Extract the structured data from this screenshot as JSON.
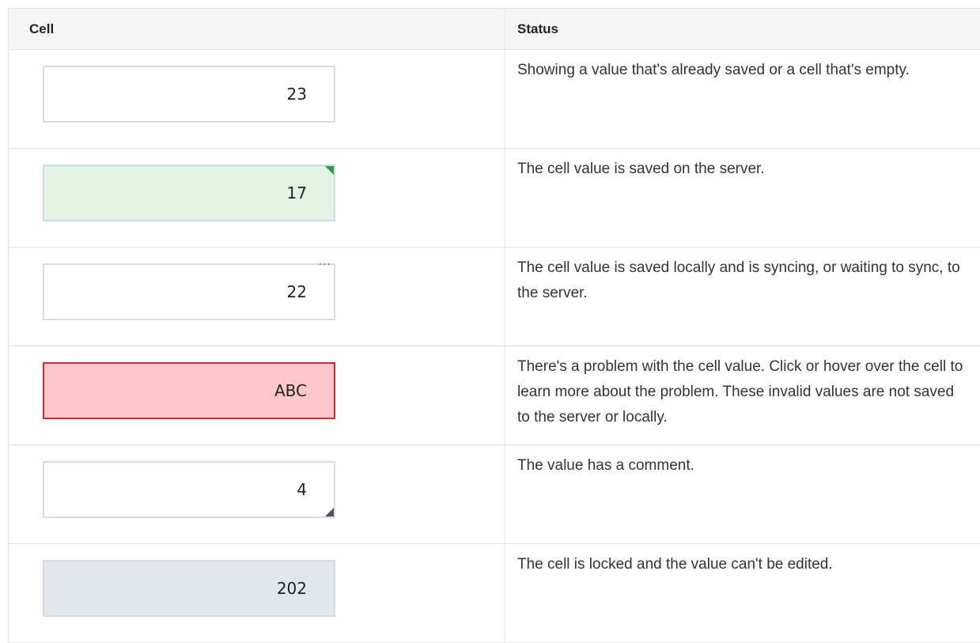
{
  "table": {
    "headers": {
      "cell": "Cell",
      "status": "Status"
    },
    "rows": [
      {
        "cell_value": "23",
        "state": "default",
        "status": "Showing a value that's already saved or a cell that's empty."
      },
      {
        "cell_value": "17",
        "state": "saved-on-server",
        "indicator": "green-corner-flag",
        "status": "The cell value is saved on the server."
      },
      {
        "cell_value": "22",
        "state": "syncing",
        "indicator": "ellipsis",
        "indicator_text": "...",
        "status": "The cell value is saved locally and is syncing, or waiting to sync, to the server."
      },
      {
        "cell_value": "ABC",
        "state": "invalid",
        "status": "There's a problem with the cell value. Click or hover over the cell to learn more about the problem. These invalid values are not saved to the server or locally."
      },
      {
        "cell_value": "4",
        "state": "has-comment",
        "indicator": "dark-corner-flag",
        "status": "The value has a comment."
      },
      {
        "cell_value": "202",
        "state": "locked",
        "status": "The cell is locked and the value can't be edited."
      }
    ]
  },
  "colors": {
    "header_bg": "#f5f5f5",
    "border": "#e3e3e3",
    "saved_bg": "#e2f3e3",
    "saved_flag": "#2e9a45",
    "invalid_bg": "#ffc7cc",
    "invalid_border": "#d02a30",
    "locked_bg": "#e2e7ee",
    "comment_flag": "#4a5160"
  }
}
